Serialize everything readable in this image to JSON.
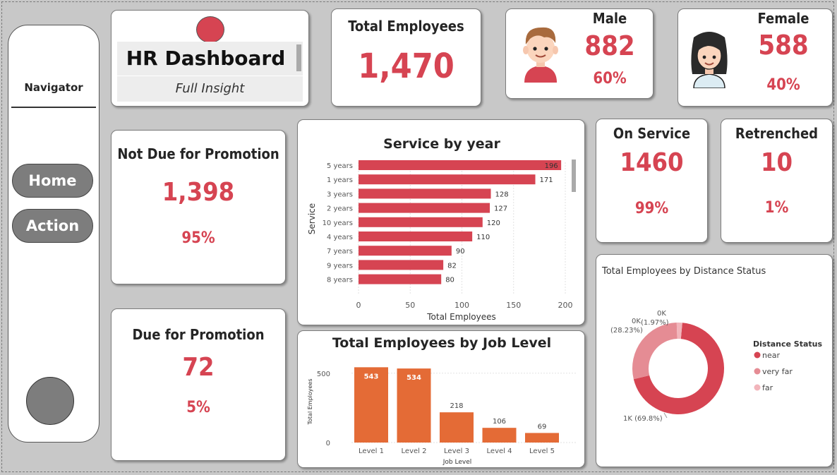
{
  "navigator": {
    "title": "Navigator",
    "buttons": [
      "Home",
      "Action"
    ]
  },
  "header": {
    "title": "HR Dashboard",
    "subtitle": "Full Insight"
  },
  "total_employees": {
    "label": "Total Employees",
    "value": "1,470"
  },
  "male": {
    "label": "Male",
    "value": "882",
    "percent": "60%"
  },
  "female": {
    "label": "Female",
    "value": "588",
    "percent": "40%"
  },
  "not_due_promotion": {
    "label": "Not Due for Promotion",
    "value": "1,398",
    "percent": "95%"
  },
  "due_promotion": {
    "label": "Due for Promotion",
    "value": "72",
    "percent": "5%"
  },
  "on_service": {
    "label": "On Service",
    "value": "1460",
    "percent": "99%"
  },
  "retrenched": {
    "label": "Retrenched",
    "value": "10",
    "percent": "1%"
  },
  "colors": {
    "accent": "#d64452",
    "bar_orange": "#e46b36",
    "pink": "#e58c94",
    "light_pink": "#f2b5bb"
  },
  "chart_data": [
    {
      "type": "bar",
      "orientation": "horizontal",
      "title": "Service by year",
      "xlabel": "Total Employees",
      "ylabel": "Service",
      "categories": [
        "5 years",
        "1 years",
        "3 years",
        "2 years",
        "10 years",
        "4 years",
        "7 years",
        "9 years",
        "8 years"
      ],
      "values": [
        196,
        171,
        128,
        127,
        120,
        110,
        90,
        82,
        80
      ],
      "xticks": [
        "0",
        "50",
        "100",
        "150",
        "200"
      ],
      "xlim": [
        0,
        200
      ]
    },
    {
      "type": "bar",
      "title": "Total Employees by Job Level",
      "xlabel": "Job Level",
      "ylabel": "Total Employees",
      "categories": [
        "Level 1",
        "Level 2",
        "Level 3",
        "Level 4",
        "Level 5"
      ],
      "values": [
        543,
        534,
        218,
        106,
        69
      ],
      "yticks": [
        "0",
        "500"
      ],
      "ylim": [
        0,
        560
      ]
    },
    {
      "type": "pie",
      "donut": true,
      "title": "Total Employees by Distance Status",
      "legend_title": "Distance Status",
      "legend_position": "right",
      "series": [
        {
          "name": "near",
          "label": "1K (69.8%)",
          "fraction": 0.698
        },
        {
          "name": "very far",
          "label_value": "0K",
          "label_pct": "(28.23%)",
          "fraction": 0.2823
        },
        {
          "name": "far",
          "label_value": "0K",
          "label_pct": "(1.97%)",
          "fraction": 0.0197
        }
      ]
    }
  ]
}
